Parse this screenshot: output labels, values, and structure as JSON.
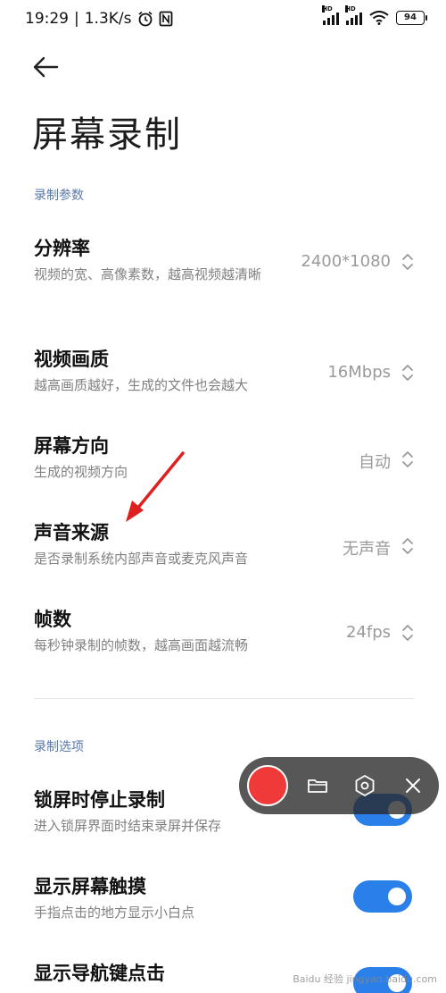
{
  "status_bar": {
    "time": "19:29",
    "net_speed": "1.3K/s",
    "battery": "94"
  },
  "page": {
    "title": "屏幕录制"
  },
  "recording_params": {
    "label": "录制参数",
    "items": [
      {
        "title": "分辨率",
        "desc": "视频的宽、高像素数，越高视频越清晰",
        "value": "2400*1080"
      },
      {
        "title": "视频画质",
        "desc": "越高画质越好，生成的文件也会越大",
        "value": "16Mbps"
      },
      {
        "title": "屏幕方向",
        "desc": "生成的视频方向",
        "value": "自动"
      },
      {
        "title": "声音来源",
        "desc": "是否录制系统内部声音或麦克风声音",
        "value": "无声音"
      },
      {
        "title": "帧数",
        "desc": "每秒钟录制的帧数，越高画面越流畅",
        "value": "24fps"
      }
    ]
  },
  "recording_options": {
    "label": "录制选项",
    "items": [
      {
        "title": "锁屏时停止录制",
        "desc": "进入锁屏界面时结束录屏并保存",
        "enabled": true
      },
      {
        "title": "显示屏幕触摸",
        "desc": "手指点击的地方显示小白点",
        "enabled": true
      },
      {
        "title": "显示导航键点击",
        "desc": "",
        "enabled": true
      }
    ]
  },
  "watermark": "Baidu 经验 jingyan.baidu.com",
  "colors": {
    "accent": "#2a7fe8",
    "record": "#f03a3a",
    "annotation": "#e02020",
    "section": "#5a79a8"
  }
}
